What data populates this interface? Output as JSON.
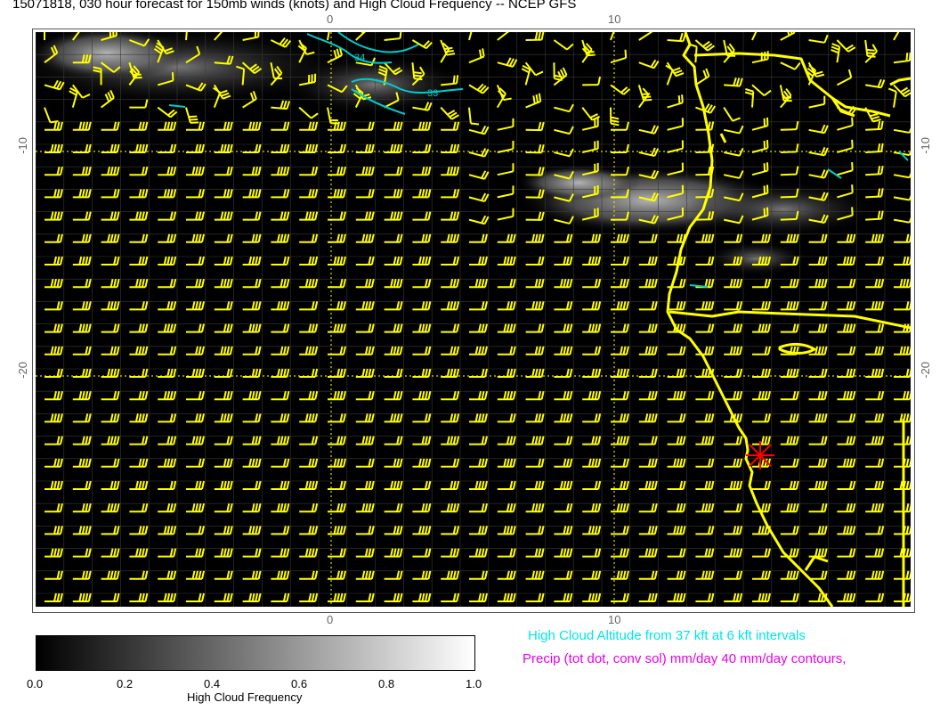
{
  "title": "15071818, 030 hour forecast for 150mb winds (knots) and High Cloud Frequency -- NCEP GFS",
  "map": {
    "lon_ticks_top": [
      "0",
      "10"
    ],
    "lon_ticks_bottom": [
      "0",
      "10"
    ],
    "lat_ticks_left": [
      "-10",
      "-20"
    ],
    "lat_ticks_right": [
      "-10",
      "-20"
    ],
    "background_color": "#000000",
    "barb_color": "#ffff00",
    "coast_color": "#ffff00",
    "contour_color": "#00cccc",
    "marker_color": "#ff0000",
    "contour_labels": [
      "34",
      "33"
    ]
  },
  "colorbar": {
    "title": "High Cloud Frequency",
    "tick_labels": [
      "0.0",
      "0.2",
      "0.4",
      "0.6",
      "0.8",
      "1.0"
    ]
  },
  "notes": {
    "cloud_altitude": "High Cloud Altitude from 37 kft at 6 kft intervals",
    "precip": "Precip (tot dot, conv sol) mm/day 40 mm/day contours,"
  }
}
